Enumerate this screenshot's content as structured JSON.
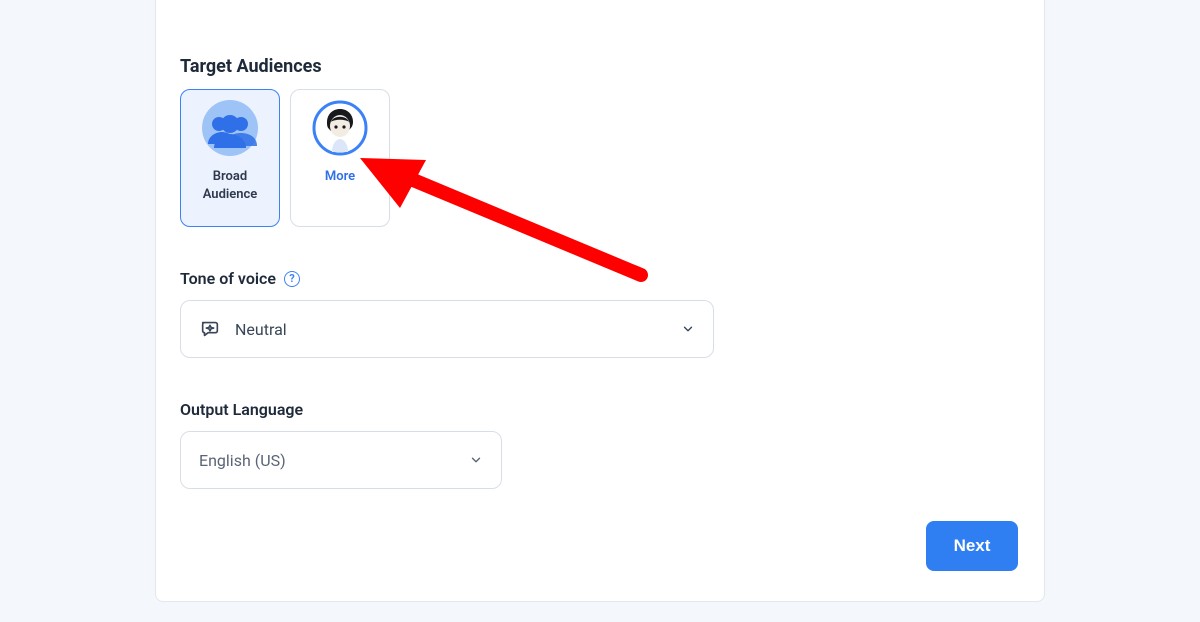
{
  "sections": {
    "audiences_heading": "Target Audiences",
    "tone_heading": "Tone of voice",
    "lang_heading": "Output Language"
  },
  "audiences": {
    "broad_label": "Broad Audience",
    "more_label": "More"
  },
  "tone": {
    "value": "Neutral"
  },
  "language": {
    "value": "English (US)"
  },
  "actions": {
    "next_label": "Next"
  },
  "help": {
    "glyph": "?"
  },
  "colors": {
    "accent": "#2f7ff3",
    "selected_bg": "#ecf2fe",
    "annotation": "#ff0000"
  }
}
